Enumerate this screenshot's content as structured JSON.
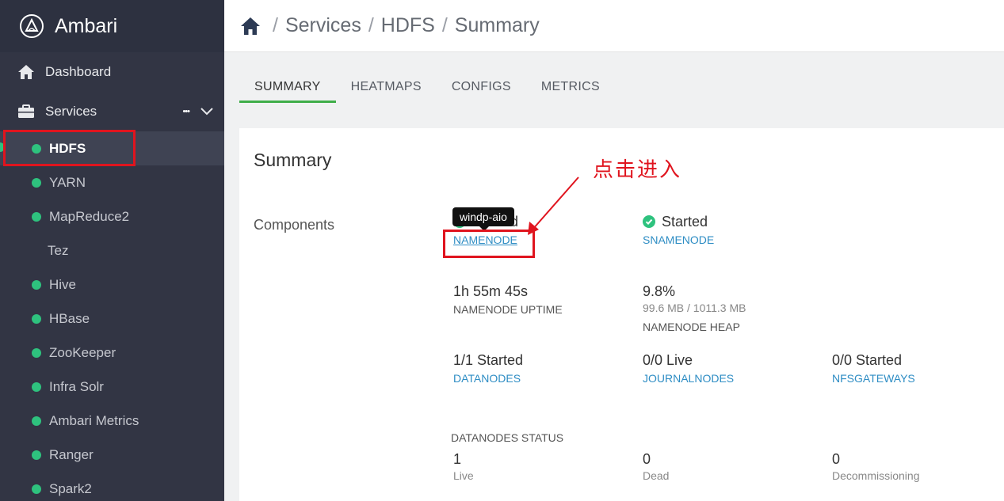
{
  "app": {
    "name": "Ambari"
  },
  "sidebar": {
    "dashboard": "Dashboard",
    "services": "Services",
    "services_more": "•••",
    "items": [
      {
        "label": "HDFS",
        "status": "green",
        "active": true
      },
      {
        "label": "YARN",
        "status": "green"
      },
      {
        "label": "MapReduce2",
        "status": "green"
      },
      {
        "label": "Tez",
        "status": "none"
      },
      {
        "label": "Hive",
        "status": "green"
      },
      {
        "label": "HBase",
        "status": "green"
      },
      {
        "label": "ZooKeeper",
        "status": "green"
      },
      {
        "label": "Infra Solr",
        "status": "green"
      },
      {
        "label": "Ambari Metrics",
        "status": "green"
      },
      {
        "label": "Ranger",
        "status": "green"
      },
      {
        "label": "Spark2",
        "status": "green"
      }
    ]
  },
  "breadcrumb": {
    "sep": "/",
    "services": "Services",
    "service": "HDFS",
    "page": "Summary"
  },
  "tabs": [
    "SUMMARY",
    "HEATMAPS",
    "CONFIGS",
    "METRICS"
  ],
  "summary": {
    "title": "Summary",
    "components_label": "Components",
    "namenode": {
      "status": "Started",
      "link": "NAMENODE",
      "tooltip": "windp-aio"
    },
    "snamenode": {
      "status": "Started",
      "link": "SNAMENODE"
    },
    "uptime": {
      "value": "1h 55m 45s",
      "label": "NAMENODE UPTIME"
    },
    "heap": {
      "value": "9.8%",
      "detail": "99.6 MB / 1011.3 MB",
      "label": "NAMENODE HEAP"
    },
    "datanodes": {
      "value": "1/1 Started",
      "link": "DATANODES"
    },
    "journalnodes": {
      "value": "0/0 Live",
      "link": "JOURNALNODES"
    },
    "nfsgateways": {
      "value": "0/0 Started",
      "link": "NFSGATEWAYS"
    },
    "datanodes_status": {
      "label": "DATANODES STATUS",
      "live": {
        "value": "1",
        "label": "Live"
      },
      "dead": {
        "value": "0",
        "label": "Dead"
      },
      "decommissioning": {
        "value": "0",
        "label": "Decommissioning"
      }
    }
  },
  "annotation": {
    "note": "点击进入"
  },
  "colors": {
    "sidebar": "#323544",
    "status_green": "#2ec27e",
    "link": "#2e8dc4",
    "tab_active": "#3fae49",
    "highlight": "#e0141e"
  }
}
